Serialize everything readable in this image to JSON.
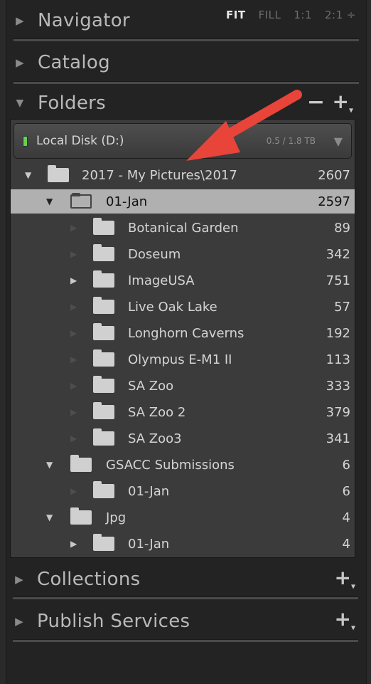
{
  "navigator": {
    "title": "Navigator",
    "zoom_options": [
      "FIT",
      "FILL",
      "1:1",
      "2:1 ÷"
    ]
  },
  "catalog": {
    "title": "Catalog"
  },
  "folders": {
    "title": "Folders",
    "minus_label": "−",
    "plus_label": "+",
    "disk": {
      "name": "Local Disk (D:)",
      "usage": "0.5 / 1.8 TB"
    },
    "rows": [
      {
        "name": "2017 - My Pictures\\2017",
        "count": "2607"
      },
      {
        "name": "01-Jan",
        "count": "2597"
      },
      {
        "name": "Botanical Garden",
        "count": "89"
      },
      {
        "name": "Doseum",
        "count": "342"
      },
      {
        "name": "ImageUSA",
        "count": "751"
      },
      {
        "name": "Live Oak Lake",
        "count": "57"
      },
      {
        "name": "Longhorn Caverns",
        "count": "192"
      },
      {
        "name": "Olympus E-M1 II",
        "count": "113"
      },
      {
        "name": "SA Zoo",
        "count": "333"
      },
      {
        "name": "SA Zoo 2",
        "count": "379"
      },
      {
        "name": "SA Zoo3",
        "count": "341"
      },
      {
        "name": "GSACC Submissions",
        "count": "6"
      },
      {
        "name": "01-Jan",
        "count": "6"
      },
      {
        "name": "Jpg",
        "count": "4"
      },
      {
        "name": "01-Jan",
        "count": "4"
      }
    ]
  },
  "collections": {
    "title": "Collections",
    "plus_label": "+"
  },
  "publish_services": {
    "title": "Publish Services",
    "plus_label": "+"
  },
  "colors": {
    "annotation_arrow": "#e8443a",
    "selected_row": "#b0b0b0",
    "disk_led": "#6bd04a"
  }
}
